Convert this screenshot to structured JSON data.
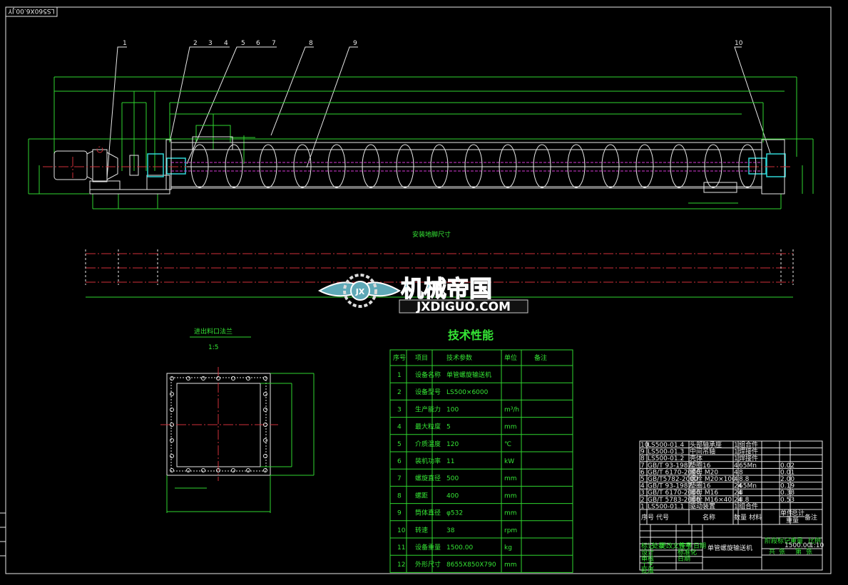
{
  "drawing_number": "LS560X6.00.JY",
  "balloons": [
    "1",
    "2",
    "3",
    "4",
    "5",
    "6",
    "7",
    "8",
    "9",
    "10"
  ],
  "install_label": "安装地脚尺寸",
  "flange_view": {
    "title": "进出料口法兰",
    "scale": "1:5"
  },
  "watermark": {
    "cn": "机械帝国",
    "en": "JXDIGUO.COM",
    "emblem": "JX"
  },
  "tech_table": {
    "title": "技术性能",
    "headers": [
      "序号",
      "项目",
      "技术参数",
      "单位",
      "备注"
    ],
    "rows": [
      [
        "1",
        "设备名称",
        "单管螺旋输送机",
        "",
        ""
      ],
      [
        "2",
        "设备型号",
        "LS500×6000",
        "",
        ""
      ],
      [
        "3",
        "生产能力",
        "100",
        "m³/h",
        ""
      ],
      [
        "4",
        "最大粒度",
        "5",
        "mm",
        ""
      ],
      [
        "5",
        "介质温度",
        "120",
        "℃",
        ""
      ],
      [
        "6",
        "装机功率",
        "11",
        "kW",
        ""
      ],
      [
        "7",
        "螺旋直径",
        "500",
        "mm",
        ""
      ],
      [
        "8",
        "螺距",
        "400",
        "mm",
        ""
      ],
      [
        "9",
        "筒体直径",
        "φ532",
        "mm",
        ""
      ],
      [
        "10",
        "转速",
        "38",
        "rpm",
        ""
      ],
      [
        "11",
        "设备重量",
        "1500.00",
        "kg",
        ""
      ],
      [
        "12",
        "外形尺寸",
        "8655X850X790",
        "mm",
        ""
      ]
    ]
  },
  "parts_list": {
    "rows": [
      [
        "10",
        "LS500-01.4",
        "头部轴承座",
        "1",
        "组合件",
        "",
        ""
      ],
      [
        "9",
        "LS500-01.3",
        "中间吊轴",
        "1",
        "焊接件",
        "",
        ""
      ],
      [
        "8",
        "LS500-01.2",
        "壳体",
        "1",
        "焊接件",
        "",
        ""
      ],
      [
        "7",
        "GB/T 93-1987",
        "垫圈16",
        "4",
        "65Mn",
        "",
        "0.02"
      ],
      [
        "6",
        "GB/T 6170-2000",
        "螺母 M20",
        "4",
        "8",
        "",
        "0.01"
      ],
      [
        "5",
        "GB/T5782-2000",
        "螺栓 M20×100",
        "4",
        "8.8",
        "",
        "2.00"
      ],
      [
        "4",
        "GB/T 93-1987",
        "垫圈16",
        "24",
        "65Mn",
        "",
        "0.19"
      ],
      [
        "3",
        "GB/T 6170-2000",
        "螺母 M16",
        "24",
        "8",
        "",
        "0.38"
      ],
      [
        "2",
        "GB/T 5783-2000",
        "螺栓 M16×40",
        "24",
        "8.8",
        "",
        "0.53"
      ],
      [
        "1",
        "LS500-01.1",
        "驱动装置",
        "1",
        "组合件",
        "",
        ""
      ]
    ],
    "headers": [
      "序号",
      "代号",
      "名称",
      "数量",
      "材料",
      "单件",
      "总计",
      "备注"
    ],
    "weight_label": "重量"
  },
  "title_block": {
    "name": "单管螺旋输送机",
    "labels": [
      "标记",
      "处数",
      "更改文件号",
      "签字",
      "日期",
      "设计",
      "审核",
      "工艺",
      "批准",
      "标准化",
      "日期"
    ],
    "stage_label": "阶段标记",
    "weight_label": "重量",
    "scale_label": "比例",
    "weight_scale": "1500.00",
    "scale": "1:10",
    "sheet": [
      "共",
      "张",
      "第",
      "张"
    ]
  }
}
